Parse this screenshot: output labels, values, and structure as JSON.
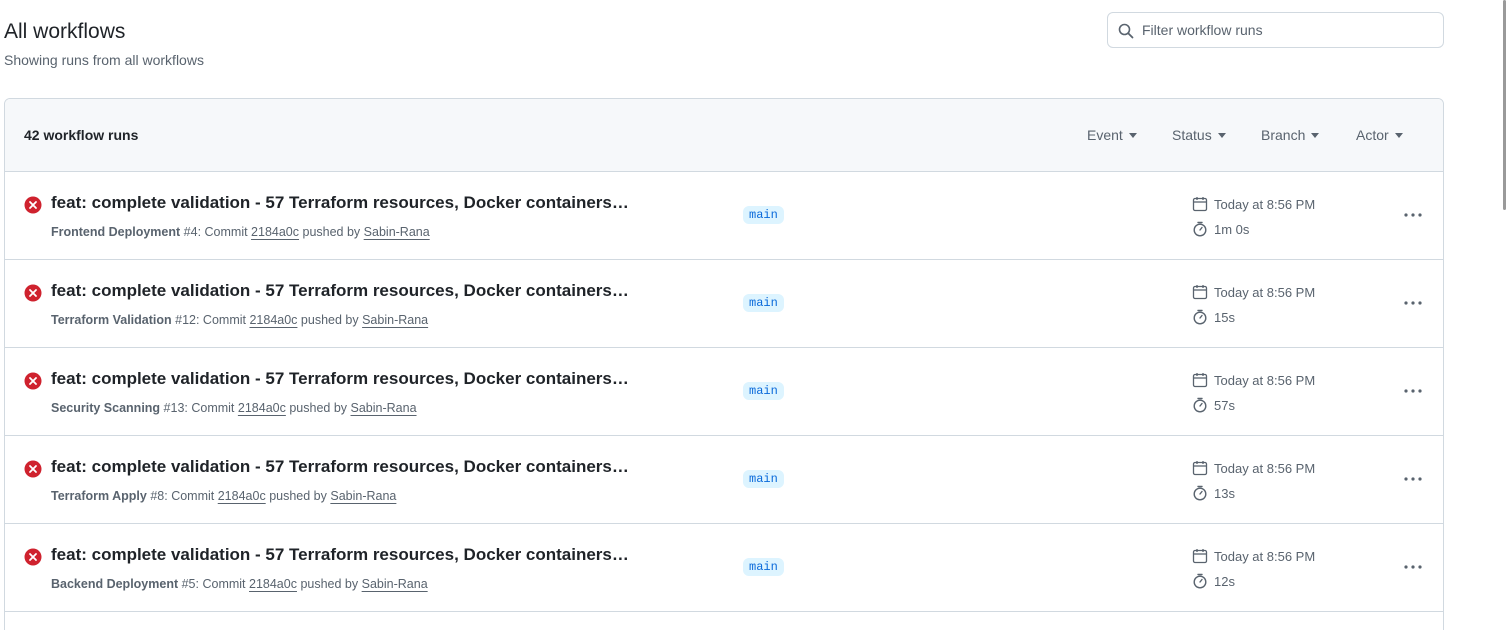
{
  "header": {
    "title": "All workflows",
    "subtitle": "Showing runs from all workflows"
  },
  "search": {
    "placeholder": "Filter workflow runs",
    "value": ""
  },
  "runs_header": {
    "count_label": "42 workflow runs",
    "filters": [
      "Event",
      "Status",
      "Branch",
      "Actor"
    ]
  },
  "colors": {
    "failure": "#cf222e",
    "branch_bg": "#ddf4ff",
    "branch_fg": "#0969da"
  },
  "runs": [
    {
      "status": "failure",
      "title": "feat: complete validation - 57 Terraform resources, Docker containers…",
      "workflow": "Frontend Deployment",
      "number": "#4",
      "commit_prefix": ": Commit",
      "commit": "2184a0c",
      "pushed_by": "pushed by",
      "actor": "Sabin-Rana",
      "branch": "main",
      "time": "Today at 8:56 PM",
      "duration": "1m 0s"
    },
    {
      "status": "failure",
      "title": "feat: complete validation - 57 Terraform resources, Docker containers…",
      "workflow": "Terraform Validation",
      "number": "#12",
      "commit_prefix": ": Commit",
      "commit": "2184a0c",
      "pushed_by": "pushed by",
      "actor": "Sabin-Rana",
      "branch": "main",
      "time": "Today at 8:56 PM",
      "duration": "15s"
    },
    {
      "status": "failure",
      "title": "feat: complete validation - 57 Terraform resources, Docker containers…",
      "workflow": "Security Scanning",
      "number": "#13",
      "commit_prefix": ": Commit",
      "commit": "2184a0c",
      "pushed_by": "pushed by",
      "actor": "Sabin-Rana",
      "branch": "main",
      "time": "Today at 8:56 PM",
      "duration": "57s"
    },
    {
      "status": "failure",
      "title": "feat: complete validation - 57 Terraform resources, Docker containers…",
      "workflow": "Terraform Apply",
      "number": "#8",
      "commit_prefix": ": Commit",
      "commit": "2184a0c",
      "pushed_by": "pushed by",
      "actor": "Sabin-Rana",
      "branch": "main",
      "time": "Today at 8:56 PM",
      "duration": "13s"
    },
    {
      "status": "failure",
      "title": "feat: complete validation - 57 Terraform resources, Docker containers…",
      "workflow": "Backend Deployment",
      "number": "#5",
      "commit_prefix": ": Commit",
      "commit": "2184a0c",
      "pushed_by": "pushed by",
      "actor": "Sabin-Rana",
      "branch": "main",
      "time": "Today at 8:56 PM",
      "duration": "12s"
    }
  ]
}
